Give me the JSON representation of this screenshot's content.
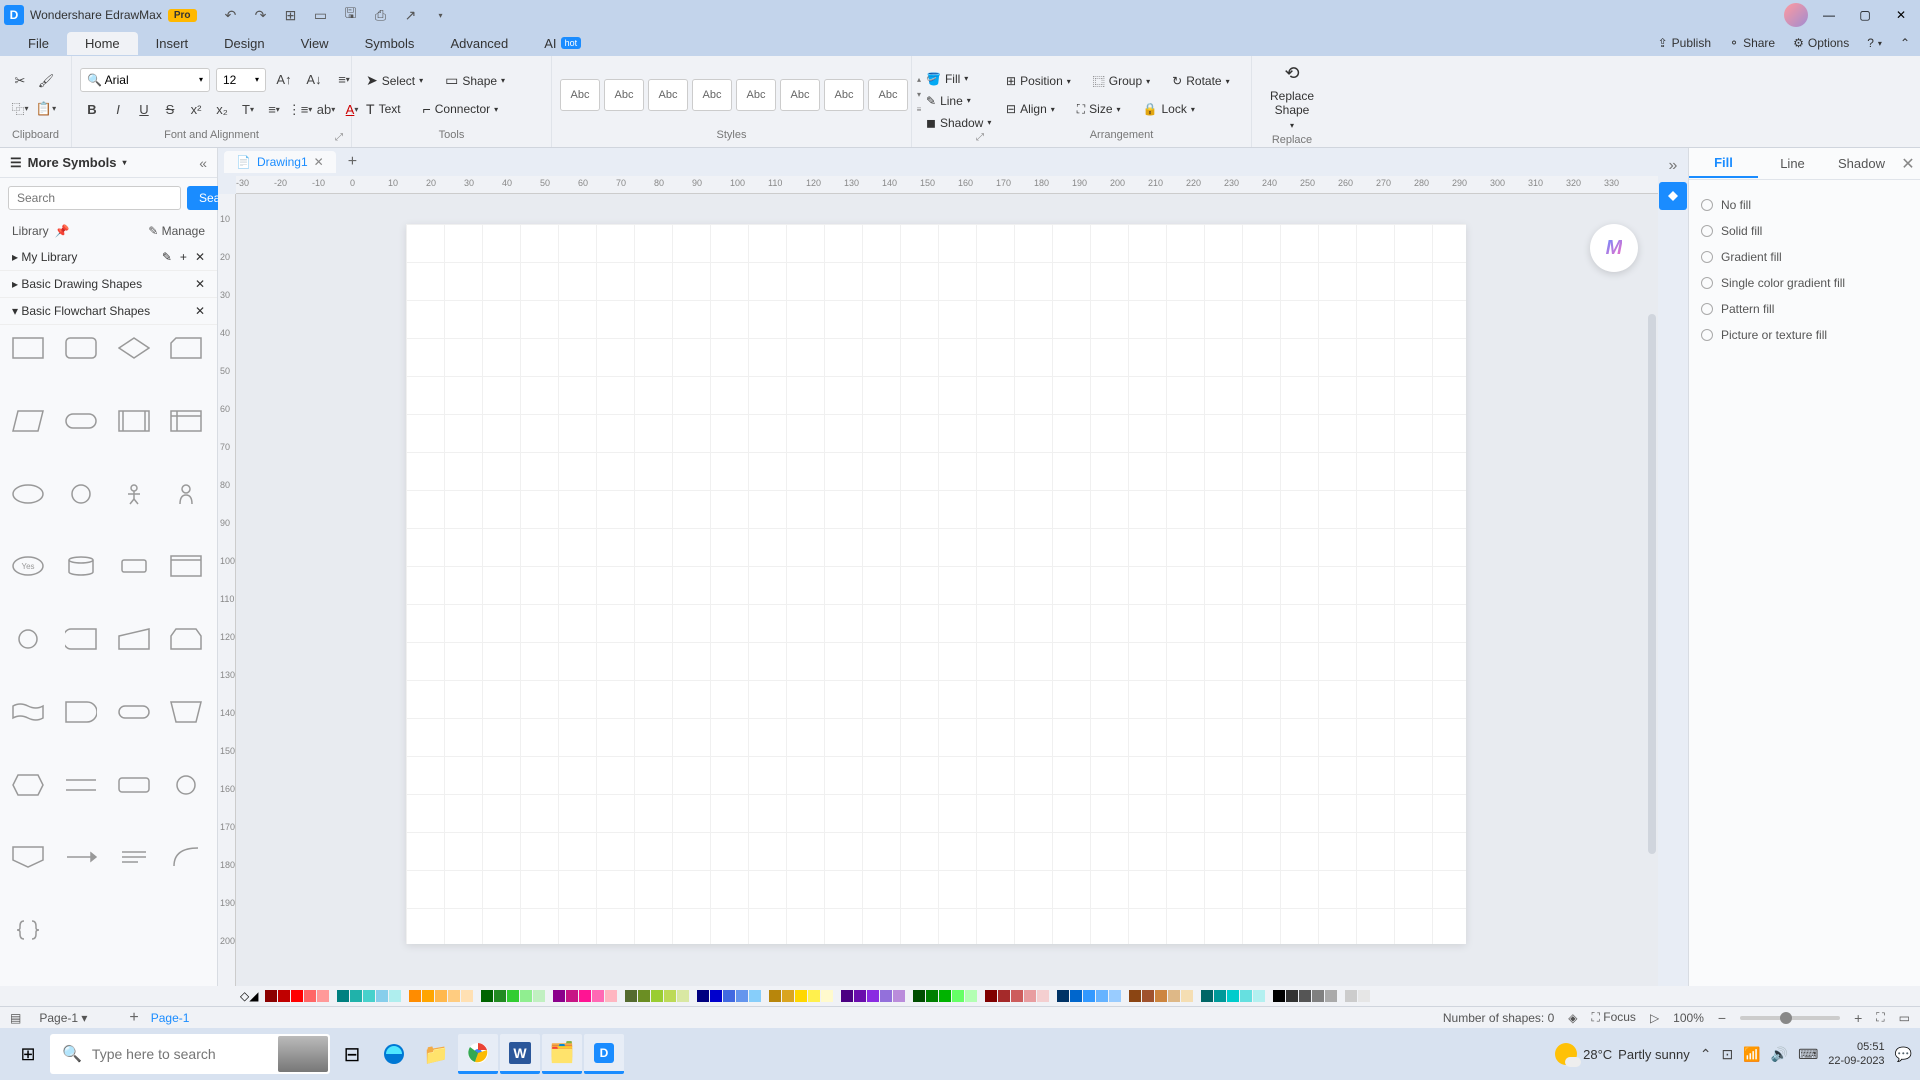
{
  "app": {
    "title": "Wondershare EdrawMax",
    "badge": "Pro"
  },
  "menubar": {
    "items": [
      "File",
      "Home",
      "Insert",
      "Design",
      "View",
      "Symbols",
      "Advanced"
    ],
    "ai": "AI",
    "hot": "hot",
    "active": "Home",
    "right": {
      "publish": "Publish",
      "share": "Share",
      "options": "Options"
    }
  },
  "ribbon": {
    "clipboard": {
      "label": "Clipboard"
    },
    "fontAlign": {
      "label": "Font and Alignment",
      "font": "Arial",
      "size": "12"
    },
    "tools": {
      "label": "Tools",
      "select": "Select",
      "shape": "Shape",
      "text": "Text",
      "connector": "Connector"
    },
    "styles": {
      "label": "Styles",
      "sample": "Abc"
    },
    "fill": "Fill",
    "line": "Line",
    "shadow": "Shadow",
    "arrangement": {
      "label": "Arrangement",
      "position": "Position",
      "group": "Group",
      "rotate": "Rotate",
      "align": "Align",
      "size": "Size",
      "lock": "Lock"
    },
    "replace": {
      "label": "Replace",
      "btn": "Replace\nShape"
    }
  },
  "leftPanel": {
    "title": "More Symbols",
    "searchPlaceholder": "Search",
    "searchBtn": "Search",
    "library": "Library",
    "manage": "Manage",
    "myLibrary": "My Library",
    "basicDrawing": "Basic Drawing Shapes",
    "basicFlowchart": "Basic Flowchart Shapes"
  },
  "docTab": "Drawing1",
  "rulerH": [
    -30,
    -20,
    -10,
    0,
    10,
    20,
    30,
    40,
    50,
    60,
    70,
    80,
    90,
    100,
    110,
    120,
    130,
    140,
    150,
    160,
    170,
    180,
    190,
    200,
    210,
    220,
    230,
    240,
    250,
    260,
    270,
    280,
    290,
    300,
    310,
    320,
    330
  ],
  "rulerV": [
    10,
    20,
    30,
    40,
    50,
    60,
    70,
    80,
    90,
    100,
    110,
    120,
    130,
    140,
    150,
    160,
    170,
    180,
    190,
    200
  ],
  "rightPanel": {
    "tabs": {
      "fill": "Fill",
      "line": "Line",
      "shadow": "Shadow"
    },
    "fillOptions": [
      "No fill",
      "Solid fill",
      "Gradient fill",
      "Single color gradient fill",
      "Pattern fill",
      "Picture or texture fill"
    ]
  },
  "colorbar": [
    "#8b0000",
    "#c00000",
    "#ff0000",
    "#ff6666",
    "#ff9999",
    "#008080",
    "#20b2aa",
    "#48d1cc",
    "#87ceeb",
    "#afeeee",
    "#ff8c00",
    "#ffa500",
    "#ffb84d",
    "#ffcc80",
    "#ffe0b3",
    "#006400",
    "#228b22",
    "#32cd32",
    "#90ee90",
    "#c1f0c1",
    "#8b008b",
    "#c71585",
    "#ff1493",
    "#ff69b4",
    "#ffb6c1",
    "#556b2f",
    "#6b8e23",
    "#9acd32",
    "#bdda57",
    "#d9e8a3",
    "#000080",
    "#0000cd",
    "#4169e1",
    "#6495ed",
    "#87cefa",
    "#b8860b",
    "#daa520",
    "#ffd700",
    "#fff04d",
    "#fffacd",
    "#4b0082",
    "#6a0dad",
    "#8a2be2",
    "#9370db",
    "#ba8cdb",
    "#004d00",
    "#008000",
    "#00b300",
    "#66ff66",
    "#b3ffb3",
    "#800000",
    "#a52a2a",
    "#cd5c5c",
    "#e89da0",
    "#f4cfd0",
    "#003366",
    "#0066cc",
    "#3399ff",
    "#66b3ff",
    "#99ccff",
    "#8b4513",
    "#a0522d",
    "#cd853f",
    "#deb887",
    "#f5deb3",
    "#006666",
    "#009999",
    "#00cccc",
    "#66e0e0",
    "#b3f0f0",
    "#000000",
    "#333333",
    "#555555",
    "#808080",
    "#aaaaaa",
    "#cccccc",
    "#e6e6e6"
  ],
  "status": {
    "page": "Page-1",
    "pageLink": "Page-1",
    "shapeCount": "Number of shapes: 0",
    "focus": "Focus",
    "zoom": "100%"
  },
  "taskbar": {
    "search": "Type here to search",
    "temp": "28°C",
    "condition": "Partly sunny",
    "time": "05:51",
    "date": "22-09-2023"
  }
}
